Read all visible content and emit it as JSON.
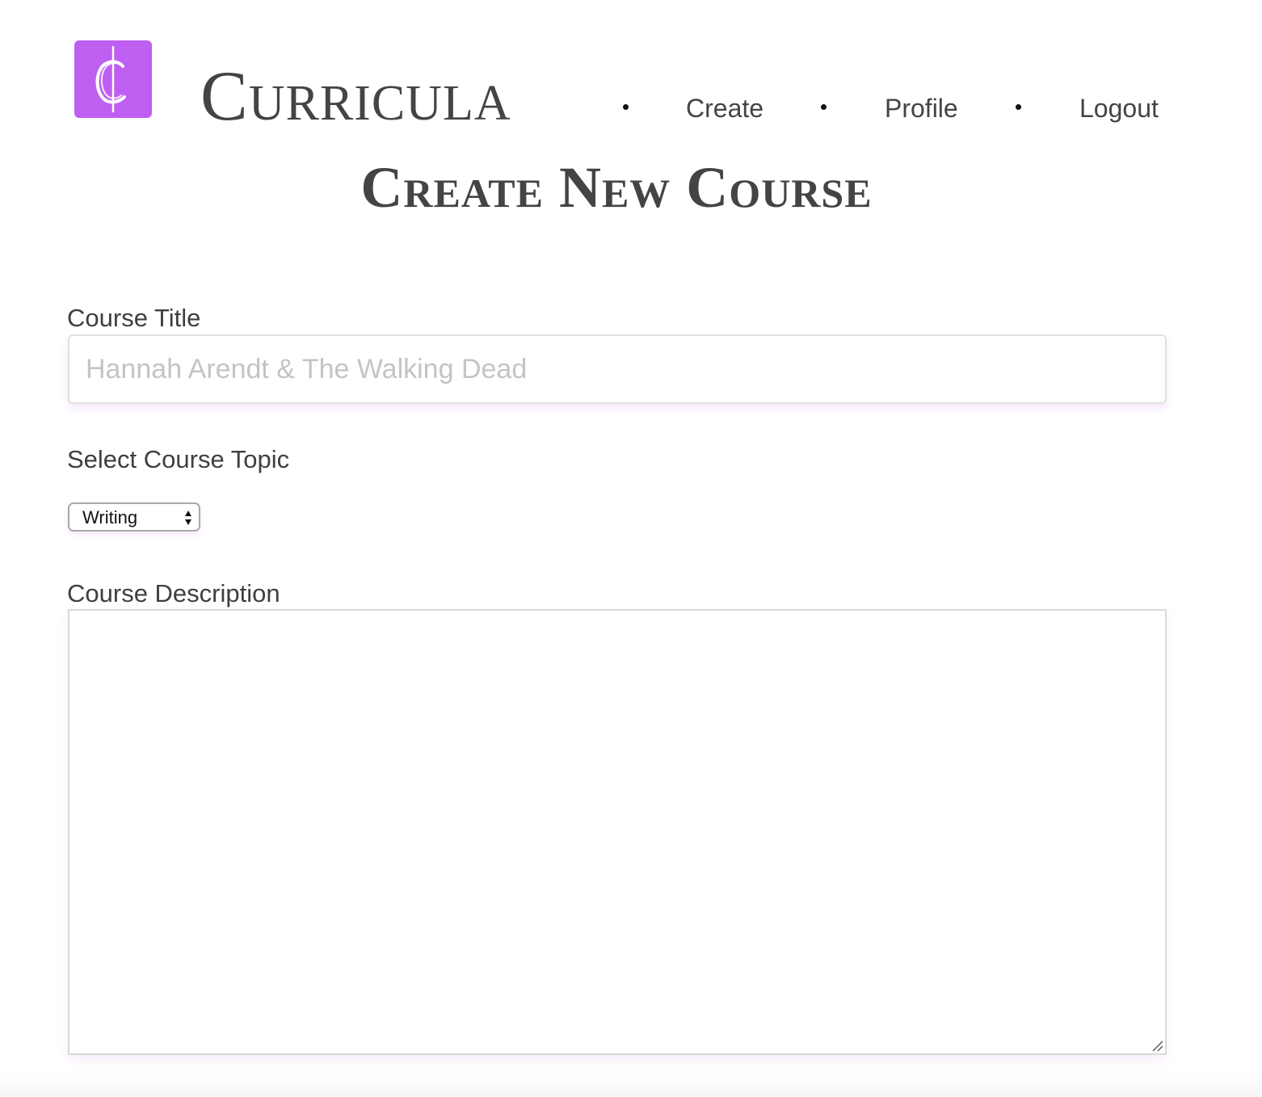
{
  "header": {
    "logo_letter": "C",
    "brand": "Curricula",
    "nav": {
      "items": [
        {
          "label": "Create"
        },
        {
          "label": "Profile"
        },
        {
          "label": "Logout"
        }
      ]
    }
  },
  "page_title": "Create New Course",
  "form": {
    "title_label": "Course Title",
    "title_placeholder": "Hannah Arendt & The Walking Dead",
    "title_value": "",
    "topic_label": "Select Course Topic",
    "topic_selected": "Writing",
    "description_label": "Course Description",
    "description_value": ""
  },
  "colors": {
    "brand_purple": "#bf5ff1",
    "text": "#444444"
  },
  "icons": {
    "logo": "curricula-c-logo-icon",
    "select": "select-arrows-icon",
    "resize": "resize-grip-icon"
  }
}
